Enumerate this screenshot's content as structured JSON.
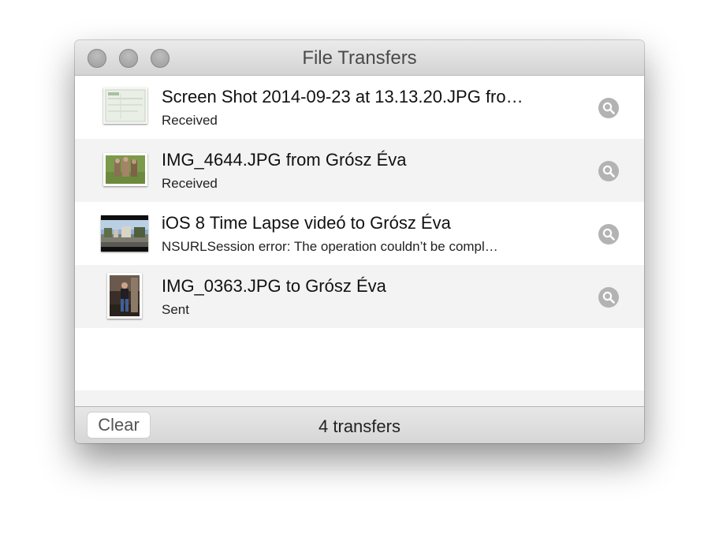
{
  "window": {
    "title": "File Transfers"
  },
  "transfers": [
    {
      "title": "Screen Shot 2014-09-23 at 13.13.20.JPG fro…",
      "status": "Received",
      "thumbnail": "screenshot-thumbnail"
    },
    {
      "title": "IMG_4644.JPG from Grósz Éva",
      "status": "Received",
      "thumbnail": "photo-thumbnail"
    },
    {
      "title": "iOS 8 Time Lapse videó to Grósz Éva",
      "status": "NSURLSession error: The operation couldn’t be compl…",
      "thumbnail": "video-thumbnail"
    },
    {
      "title": "IMG_0363.JPG to Grósz Éva",
      "status": "Sent",
      "thumbnail": "photo-thumbnail"
    }
  ],
  "footer": {
    "clear_label": "Clear",
    "count_text": "4 transfers"
  },
  "icons": {
    "reveal": "magnifying-glass-icon"
  },
  "colors": {
    "row_alternate": "#f3f3f3",
    "reveal_button": "#b3b3b3",
    "traffic_lights_inactive": "#a8a8a8"
  }
}
